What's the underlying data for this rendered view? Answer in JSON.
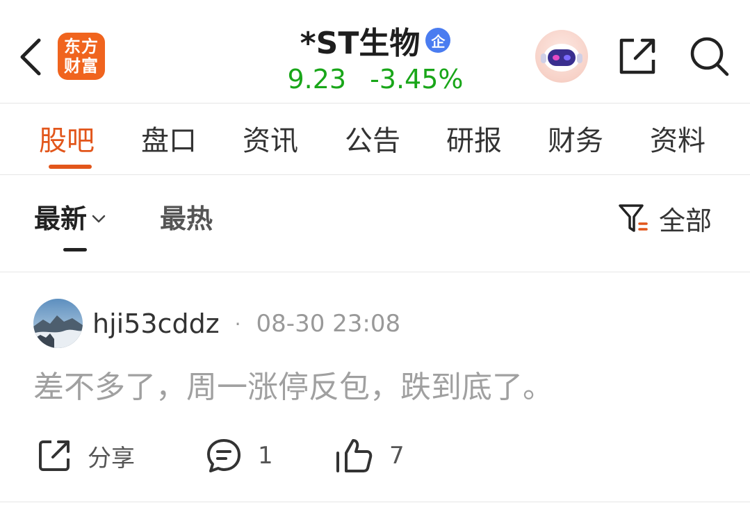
{
  "header": {
    "logo_line1": "东方",
    "logo_line2": "财富",
    "stock_name": "*ST生物",
    "badge": "企",
    "price": "9.23",
    "change_pct": "-3.45%",
    "colors": {
      "logo": "#f0641e",
      "badge": "#4a7cf0",
      "quote_down": "#19a619"
    },
    "icons": [
      "back-icon",
      "robot-assistant-icon",
      "share-icon",
      "search-icon"
    ]
  },
  "tabs": [
    {
      "label": "股吧",
      "active": true
    },
    {
      "label": "盘口"
    },
    {
      "label": "资讯"
    },
    {
      "label": "公告"
    },
    {
      "label": "研报"
    },
    {
      "label": "财务"
    },
    {
      "label": "资料"
    }
  ],
  "accent_color": "#e2561b",
  "sort": {
    "latest": "最新",
    "hot": "最热",
    "filter": "全部"
  },
  "post": {
    "username": "hji53cddz",
    "separator": "·",
    "time": "08-30 23:08",
    "content": "差不多了，周一涨停反包，跌到底了。",
    "share_label": "分享",
    "comments": "1",
    "likes": "7"
  }
}
